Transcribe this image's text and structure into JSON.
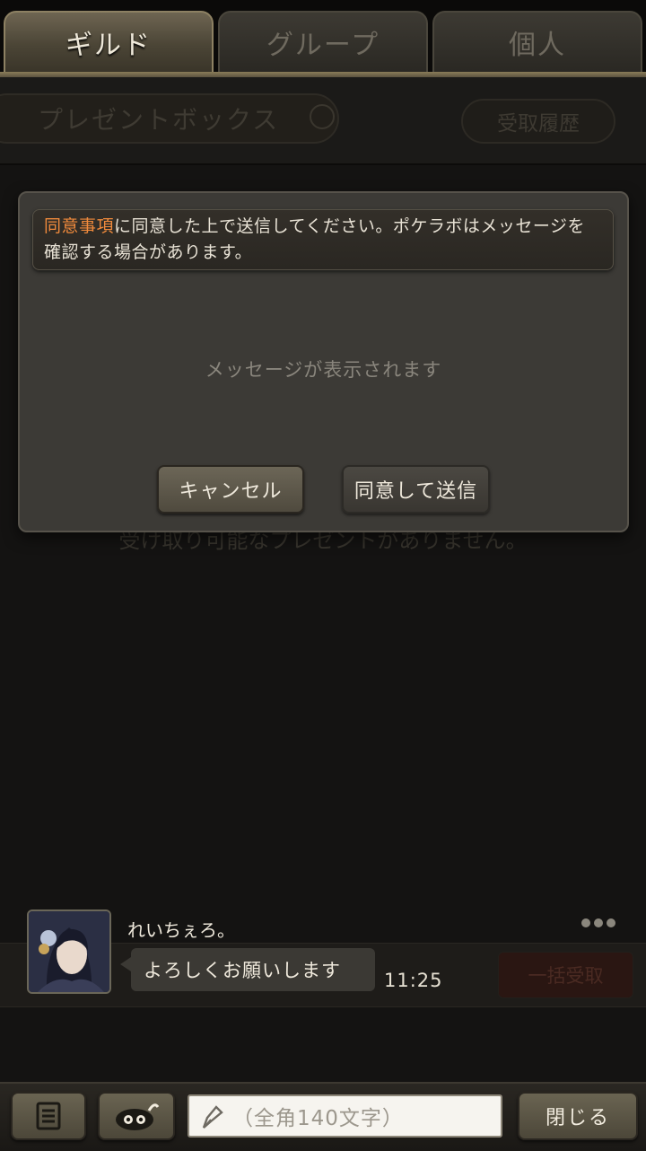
{
  "tabs": [
    {
      "label": "ギルド",
      "active": true
    },
    {
      "label": "グループ",
      "active": false
    },
    {
      "label": "個人",
      "active": false
    }
  ],
  "background": {
    "title": "プレゼントボックス",
    "history_button": "受取履歴",
    "empty_text": "受け取り可能なプレゼントがありません。",
    "receive_all_button": "一括受取"
  },
  "dialog": {
    "notice_highlight": "同意事項",
    "notice_rest": "に同意した上で送信してください。ポケラボはメッセージを確認する場合があります。",
    "message_placeholder": "メッセージが表示されます",
    "cancel_label": "キャンセル",
    "agree_send_label": "同意して送信"
  },
  "chat": {
    "sender": "れいちぇろ。",
    "message": "よろしくお願いします",
    "time": "11:25"
  },
  "bottom": {
    "input_placeholder": "（全角140文字）",
    "close_label": "閉じる"
  },
  "icons": {
    "log": "document-list-icon",
    "stamp": "stamp-face-icon",
    "pen": "pen-nib-icon"
  },
  "colors": {
    "highlight": "#f08a3c",
    "background": "#141312"
  }
}
